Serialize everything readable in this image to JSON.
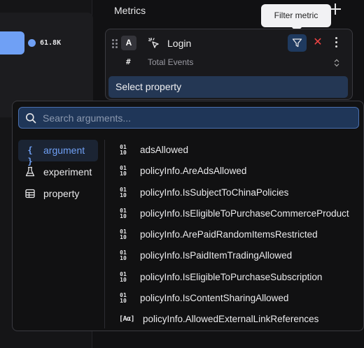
{
  "left_panel": {
    "legend_value": "61.8K",
    "accent_color": "#6fa0f5"
  },
  "metrics": {
    "title": "Metrics",
    "add_icon": "plus-icon",
    "tooltip": "Filter metric",
    "card": {
      "badge": "A",
      "event_icon": "cursor-click-icon",
      "event_name": "Login",
      "aggregation_icon": "#",
      "aggregation": "Total Events",
      "select_property": "Select property"
    }
  },
  "dropdown": {
    "search_placeholder": "Search arguments...",
    "categories": [
      {
        "icon": "{ }",
        "label": "argument",
        "active": true
      },
      {
        "icon": "flask-icon",
        "label": "experiment",
        "active": false
      },
      {
        "icon": "table-icon",
        "label": "property",
        "active": false
      }
    ],
    "arguments": [
      {
        "type": "binary",
        "icon": "01 10",
        "label": "adsAllowed"
      },
      {
        "type": "binary",
        "icon": "01 10",
        "label": "policyInfo.AreAdsAllowed"
      },
      {
        "type": "binary",
        "icon": "01 10",
        "label": "policyInfo.IsSubjectToChinaPolicies"
      },
      {
        "type": "binary",
        "icon": "01 10",
        "label": "policyInfo.IsEligibleToPurchaseCommerceProduct"
      },
      {
        "type": "binary",
        "icon": "01 10",
        "label": "policyInfo.ArePaidRandomItemsRestricted"
      },
      {
        "type": "binary",
        "icon": "01 10",
        "label": "policyInfo.IsPaidItemTradingAllowed"
      },
      {
        "type": "binary",
        "icon": "01 10",
        "label": "policyInfo.IsEligibleToPurchaseSubscription"
      },
      {
        "type": "binary",
        "icon": "01 10",
        "label": "policyInfo.IsContentSharingAllowed"
      },
      {
        "type": "text-array",
        "icon": "[Aα]",
        "label": "policyInfo.AllowedExternalLinkReferences"
      }
    ]
  }
}
